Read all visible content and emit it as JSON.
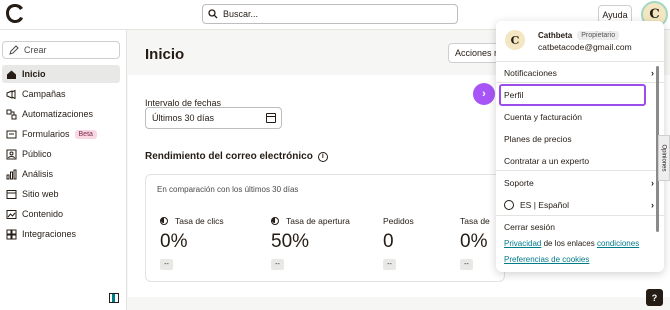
{
  "topbar": {
    "search_placeholder": "Buscar...",
    "help_label": "Ayuda",
    "avatar_initial": "C"
  },
  "sidebar": {
    "create_label": "Crear",
    "items": [
      {
        "label": "Inicio",
        "icon": "home-icon",
        "active": true
      },
      {
        "label": "Campañas",
        "icon": "megaphone-icon"
      },
      {
        "label": "Automatizaciones",
        "icon": "automation-icon"
      },
      {
        "label": "Formularios",
        "icon": "forms-icon",
        "badge": "Beta"
      },
      {
        "label": "Público",
        "icon": "audience-icon"
      },
      {
        "label": "Análisis",
        "icon": "analytics-icon"
      },
      {
        "label": "Sitio web",
        "icon": "website-icon"
      },
      {
        "label": "Contenido",
        "icon": "content-icon"
      },
      {
        "label": "Integraciones",
        "icon": "integrations-icon"
      }
    ]
  },
  "main": {
    "title": "Inicio",
    "actions_label": "Acciones rá",
    "date_range_label": "Intervalo de fechas",
    "date_range_value": "Últimos 30 días",
    "performance_title": "Rendimiento del correo electrónico",
    "comparison_text": "En comparación con los últimos 30 días",
    "stats": [
      {
        "label": "Tasa de clics",
        "value": "0%",
        "trend": "--"
      },
      {
        "label": "Tasa de apertura",
        "value": "50%",
        "trend": "--"
      },
      {
        "label": "Pedidos",
        "value": "0",
        "trend": "--"
      },
      {
        "label": "Tasa de",
        "value": "0%",
        "trend": "--"
      }
    ]
  },
  "dropdown": {
    "avatar_initial": "C",
    "name": "Cathbeta",
    "role": "Propietario",
    "email": "catbetacode@gmail.com",
    "items": [
      {
        "label": "Notificaciones",
        "chevron": "›"
      },
      {
        "label": "Perfil"
      },
      {
        "label": "Cuenta y facturación"
      },
      {
        "label": "Planes de precios"
      },
      {
        "label": "Contratar a un experto"
      },
      {
        "label": "Soporte",
        "chevron": "›"
      },
      {
        "label": "ES | Español",
        "chevron": "›"
      },
      {
        "label": "Cerrar sesión"
      }
    ],
    "privacy_prefix": "Privacidad",
    "privacy_middle": " de los enlaces ",
    "privacy_suffix": "condiciones",
    "cookies_label": "Preferencias de cookies"
  },
  "feedback_tab": "Opiniones",
  "help_button": "?",
  "colors": {
    "accent_teal": "#007c89",
    "highlight_purple": "#9b4dea",
    "beta_badge": "#f8d7e3"
  }
}
